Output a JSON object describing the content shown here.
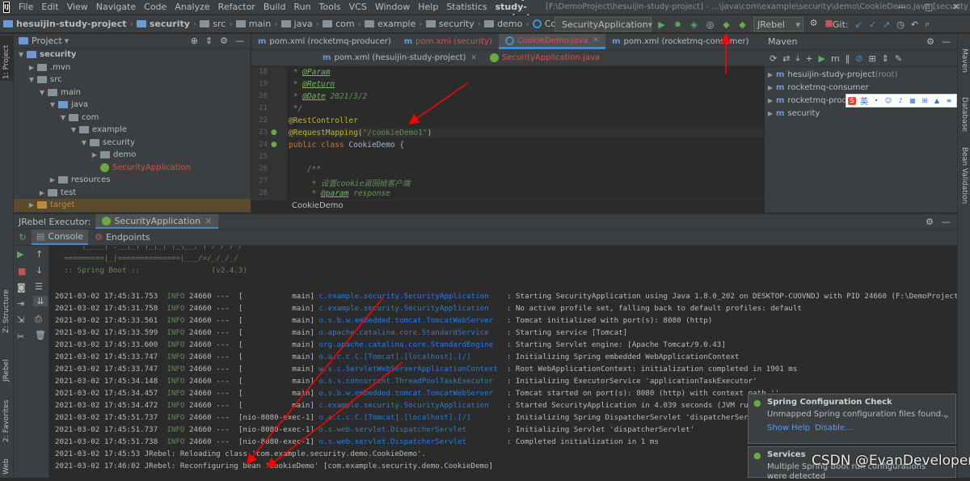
{
  "menubar": {
    "items": [
      "File",
      "Edit",
      "View",
      "Navigate",
      "Code",
      "Analyze",
      "Refactor",
      "Build",
      "Run",
      "Tools",
      "VCS",
      "Window",
      "Help",
      "Statistics"
    ],
    "project_name": "hesuijin-study-project",
    "path": "[F:\\DemoProject\\hesuijin-study-project] - ...\\java\\com\\example\\security\\demo\\CookieDemo.java [security]",
    "window_controls": [
      "—",
      "□",
      "✕"
    ]
  },
  "navbar": {
    "crumbs": [
      "hesuijin-study-project",
      "security",
      "src",
      "main",
      "java",
      "com",
      "example",
      "security",
      "demo",
      "CookieDemo"
    ],
    "run_config": "SecurityApplication",
    "jrebel": "JRebel",
    "git_label": "Git:"
  },
  "project_panel": {
    "title": "Project",
    "tree": [
      {
        "label": "security",
        "depth": 0,
        "arrow": "▼",
        "icon": "folder-blue",
        "bold": true
      },
      {
        "label": ".mvn",
        "depth": 1,
        "arrow": "▶",
        "icon": "folder"
      },
      {
        "label": "src",
        "depth": 1,
        "arrow": "▼",
        "icon": "folder"
      },
      {
        "label": "main",
        "depth": 2,
        "arrow": "▼",
        "icon": "folder"
      },
      {
        "label": "java",
        "depth": 3,
        "arrow": "▼",
        "icon": "folder-blue"
      },
      {
        "label": "com",
        "depth": 4,
        "arrow": "▼",
        "icon": "folder"
      },
      {
        "label": "example",
        "depth": 5,
        "arrow": "▼",
        "icon": "folder"
      },
      {
        "label": "security",
        "depth": 6,
        "arrow": "▼",
        "icon": "folder"
      },
      {
        "label": "demo",
        "depth": 7,
        "arrow": "▶",
        "icon": "folder"
      },
      {
        "label": "SecurityApplication",
        "depth": 7,
        "arrow": "",
        "icon": "spring",
        "red": true
      },
      {
        "label": "resources",
        "depth": 3,
        "arrow": "▶",
        "icon": "folder"
      },
      {
        "label": "test",
        "depth": 2,
        "arrow": "▶",
        "icon": "folder"
      },
      {
        "label": "target",
        "depth": 1,
        "arrow": "▶",
        "icon": "folder-orange",
        "orange": true
      }
    ]
  },
  "editor": {
    "tabs_row1": [
      {
        "label": "pom.xml (rocketmq-producer)",
        "type": "maven",
        "red": false,
        "active": false
      },
      {
        "label": "pom.xml (security)",
        "type": "maven",
        "red": true,
        "active": false
      },
      {
        "label": "CookieDemo.java",
        "type": "java",
        "red": true,
        "active": true
      },
      {
        "label": "pom.xml (rocketmq-consumer)",
        "type": "maven",
        "red": false,
        "active": false
      }
    ],
    "tabs_row2": [
      {
        "label": "pom.xml (hesuijin-study-project)",
        "type": "maven",
        "red": false
      },
      {
        "label": "SecurityApplication.java",
        "type": "spring",
        "red": true
      }
    ],
    "line_numbers": [
      "18",
      "19",
      "20",
      "21",
      "22",
      "23",
      "24",
      "25",
      "26",
      "27",
      "28"
    ],
    "lines": [
      {
        "pre": " * ",
        "tag": "@Param",
        "rest": ""
      },
      {
        "pre": " * ",
        "tag": "@Return",
        "rest": ""
      },
      {
        "pre": " * ",
        "tag": "@Date",
        "rest": " 2021/3/2"
      },
      {
        "pre": " */",
        "tag": "",
        "rest": ""
      },
      {
        "ann": "@RestController"
      },
      {
        "ann": "@RequestMapping",
        "str": "\"/cookieDemo1\""
      },
      {
        "kw": "public class ",
        "rest": "CookieDemo {"
      },
      {
        "blank": true
      },
      {
        "doc": "    /**"
      },
      {
        "doc": "     * 设置cookie返回给客户端"
      },
      {
        "doc": "     * ",
        "tag": "@param",
        "rest": " response"
      }
    ],
    "breadcrumb": "CookieDemo"
  },
  "maven": {
    "title": "Maven",
    "projects": [
      {
        "label": "hesuijin-study-project",
        "suffix": " (root)"
      },
      {
        "label": "rocketmq-consumer",
        "suffix": ""
      },
      {
        "label": "rocketmq-producer",
        "suffix": ""
      },
      {
        "label": "security",
        "suffix": ""
      }
    ]
  },
  "run_panel": {
    "tabs": [
      "JRebel Executor:",
      "SecurityApplication"
    ],
    "subtabs": [
      "Console",
      "Endpoints"
    ],
    "banner": [
      "   '  |____| .__|_| |_|_| |_\\__, | / / / /",
      "  =========|_|==============|___/=/_/_/_/",
      "  :: Spring Boot ::                (v2.4.3)"
    ],
    "logs": [
      {
        "ts": "2021-03-02 17:45:31.753",
        "lvl": "INFO",
        "pid": "24660",
        "th": "---  [           main]",
        "logger": "c.example.security.SecurityApplication   ",
        "msg": ": Starting SecurityApplication using Java 1.8.0_202 on DESKTOP-CUOVNDJ with PID 24660 (F:\\DemoProject\\hesuijin-stu"
      },
      {
        "ts": "2021-03-02 17:45:31.758",
        "lvl": "INFO",
        "pid": "24660",
        "th": "---  [           main]",
        "logger": "c.example.security.SecurityApplication   ",
        "msg": ": No active profile set, falling back to default profiles: default"
      },
      {
        "ts": "2021-03-02 17:45:33.561",
        "lvl": "INFO",
        "pid": "24660",
        "th": "---  [           main]",
        "logger": "o.s.b.w.embedded.tomcat.TomcatWebServer  ",
        "msg": ": Tomcat initialized with port(s): 8080 (http)"
      },
      {
        "ts": "2021-03-02 17:45:33.599",
        "lvl": "INFO",
        "pid": "24660",
        "th": "---  [           main]",
        "logger": "o.apache.catalina.core.StandardService   ",
        "msg": ": Starting service [Tomcat]"
      },
      {
        "ts": "2021-03-02 17:45:33.600",
        "lvl": "INFO",
        "pid": "24660",
        "th": "---  [           main]",
        "logger": "org.apache.catalina.core.StandardEngine  ",
        "msg": ": Starting Servlet engine: [Apache Tomcat/9.0.43]"
      },
      {
        "ts": "2021-03-02 17:45:33.747",
        "lvl": "INFO",
        "pid": "24660",
        "th": "---  [           main]",
        "logger": "o.a.c.c.C.[Tomcat].[localhost].[/]       ",
        "msg": ": Initializing Spring embedded WebApplicationContext"
      },
      {
        "ts": "2021-03-02 17:45:33.747",
        "lvl": "INFO",
        "pid": "24660",
        "th": "---  [           main]",
        "logger": "w.s.c.ServletWebServerApplicationContext ",
        "msg": ": Root WebApplicationContext: initialization completed in 1901 ms"
      },
      {
        "ts": "2021-03-02 17:45:34.148",
        "lvl": "INFO",
        "pid": "24660",
        "th": "---  [           main]",
        "logger": "o.s.s.concurrent.ThreadPoolTaskExecutor  ",
        "msg": ": Initializing ExecutorService 'applicationTaskExecutor'"
      },
      {
        "ts": "2021-03-02 17:45:34.457",
        "lvl": "INFO",
        "pid": "24660",
        "th": "---  [           main]",
        "logger": "o.s.b.w.embedded.tomcat.TomcatWebServer  ",
        "msg": ": Tomcat started on port(s): 8080 (http) with context path ''"
      },
      {
        "ts": "2021-03-02 17:45:34.472",
        "lvl": "INFO",
        "pid": "24660",
        "th": "---  [           main]",
        "logger": "c.example.security.SecurityApplication   ",
        "msg": ": Started SecurityApplication in 4.039 seconds (JVM running for"
      },
      {
        "ts": "2021-03-02 17:45:51.737",
        "lvl": "INFO",
        "pid": "24660",
        "th": "---  [nio-8080-exec-1]",
        "logger": "o.a.c.c.C.[Tomcat].[localhost].[/]       ",
        "msg": ": Initializing Spring DispatcherServlet 'dispatcherServlet'"
      },
      {
        "ts": "2021-03-02 17:45:51.737",
        "lvl": "INFO",
        "pid": "24660",
        "th": "---  [nio-8080-exec-1]",
        "logger": "o.s.web.servlet.DispatcherServlet        ",
        "msg": ": Initializing Servlet 'dispatcherServlet'"
      },
      {
        "ts": "2021-03-02 17:45:51.738",
        "lvl": "INFO",
        "pid": "24660",
        "th": "---  [nio-8080-exec-1]",
        "logger": "o.s.web.servlet.DispatcherServlet        ",
        "msg": ": Completed initialization in 1 ms"
      }
    ],
    "jrebel_lines": [
      "2021-03-02 17:45:53 JRebel: Reloading class 'com.example.security.demo.CookieDemo'.",
      "2021-03-02 17:46:02 JRebel: Reconfiguring bean 'cookieDemo' [com.example.security.demo.CookieDemo]"
    ]
  },
  "notifications": {
    "spring": {
      "title": "Spring Configuration Check",
      "text": "Unmapped Spring configuration files found...",
      "link1": "Show Help",
      "link2": "Disable..."
    },
    "services": {
      "title": "Services",
      "text": "Multiple Spring Boot run configurations",
      "text2": "were detected"
    }
  },
  "stripes": {
    "left": [
      "1: Project",
      "Z: Structure",
      "JRebel",
      "2: Favorites",
      "Web"
    ],
    "right": [
      "Maven",
      "Database",
      "Bean Validation"
    ]
  },
  "ime": {
    "lang": "英"
  },
  "watermark": "CSDN @EvanDeveloper",
  "colors": {
    "arrow": "#ff0000",
    "accent": "#4a88c7",
    "spring_green": "#6aab3f"
  }
}
